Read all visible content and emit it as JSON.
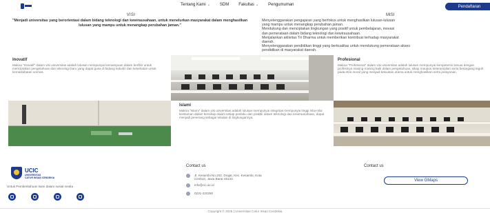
{
  "nav": {
    "items": [
      "Tentang Kami",
      "SDM",
      "Fakultas",
      "Pengumuman"
    ],
    "cta": "Pendaftaran"
  },
  "visi": {
    "title": "VISI",
    "text": "\"Menjadi universitas yang berorientasi dalam bidang teknologi dan kewirausahaan, untuk menelurkan masyarakat dalam menghasilkan lulusan yang mampu untuk menangkap perubahan jaman.\""
  },
  "misi": {
    "title": "MISI",
    "lines": [
      "Menyelenggarakan pengajaran yang berfokus untuk menghasilkan lulusan-lulusan",
      "yang mampu untuk menangkap perubahan jaman.",
      "Mendukung dan menciptakan lingkungan yang positif untuk pembelajaran, inovasi",
      "dan pemerataan dalam bidang teknologi dan kewirausahaan.",
      "Menjalankan aktivitas Tri Dharma untuk memberikan kontribusi terhadap masyarakat",
      "daerah.",
      "Menyelenggarakan pendidikan tinggi yang berkualitas untuk mendukung pemerataan akses",
      "pendidikan di masyarakat daerah."
    ]
  },
  "values": [
    {
      "title": "Inovatif",
      "text": "Makna \"Inovatif\" dalam visi universitas adalah lulusan mempunyai kemampuan dalam berfikir untuk menciptakan pengetahuan dan teknologi baru yang dapat guna di bidang industri dan kesehatan untuk kemaslahatan ummat."
    },
    {
      "title": "Islami",
      "text": "Makna \"Islami\" dalam visi universitas adalah lulusan mempunyai integritas mempunyai tinggi nilai-nilai keislaman dalam bersikap dalam setiap perilaku dan praktik dalam teknologi dan kewirausahaan, dapat menjadi penerang sebagai teladan di lingkungannya."
    },
    {
      "title": "Profesional",
      "text": "Makna \"Profesional\" dalam visi universitas adalah lulusan mempunyai kompetensi sesuai dengan profesinya masing-masing baik dalam pengetahuan, sikap maupun keterampilan serta berpegang teguh pada etos moral yang menjadi kekuatan utama untuk menghasilkan serta pelayanan."
    }
  ],
  "footer": {
    "brand": "UCIC",
    "brand_sub": [
      "UNIVERSITAS",
      "CATUR INSAN CENDEKIA"
    ],
    "description": "Untuk Pemberitahuan kami dalam sosial media",
    "socials": [
      "instagram-icon",
      "facebook-icon",
      "youtube-icon",
      "tiktok-icon"
    ],
    "contact_title": "Contact us",
    "contact": {
      "address": [
        "Jl. Kesambi No.202, Drajat, Kec. Kesambi, Kota",
        "Cirebon, Jawa Barat 45133"
      ],
      "email": "info@cic.ac.id",
      "phone": "0231-220250"
    },
    "map_title": "Contact us",
    "map_button": "View GMaps",
    "copyright": "Copyright © 2025 | Universitas Catur Insan Cendekia"
  },
  "colors": {
    "brand": "#1e3a8a",
    "accent_gold": "#f2c230"
  }
}
